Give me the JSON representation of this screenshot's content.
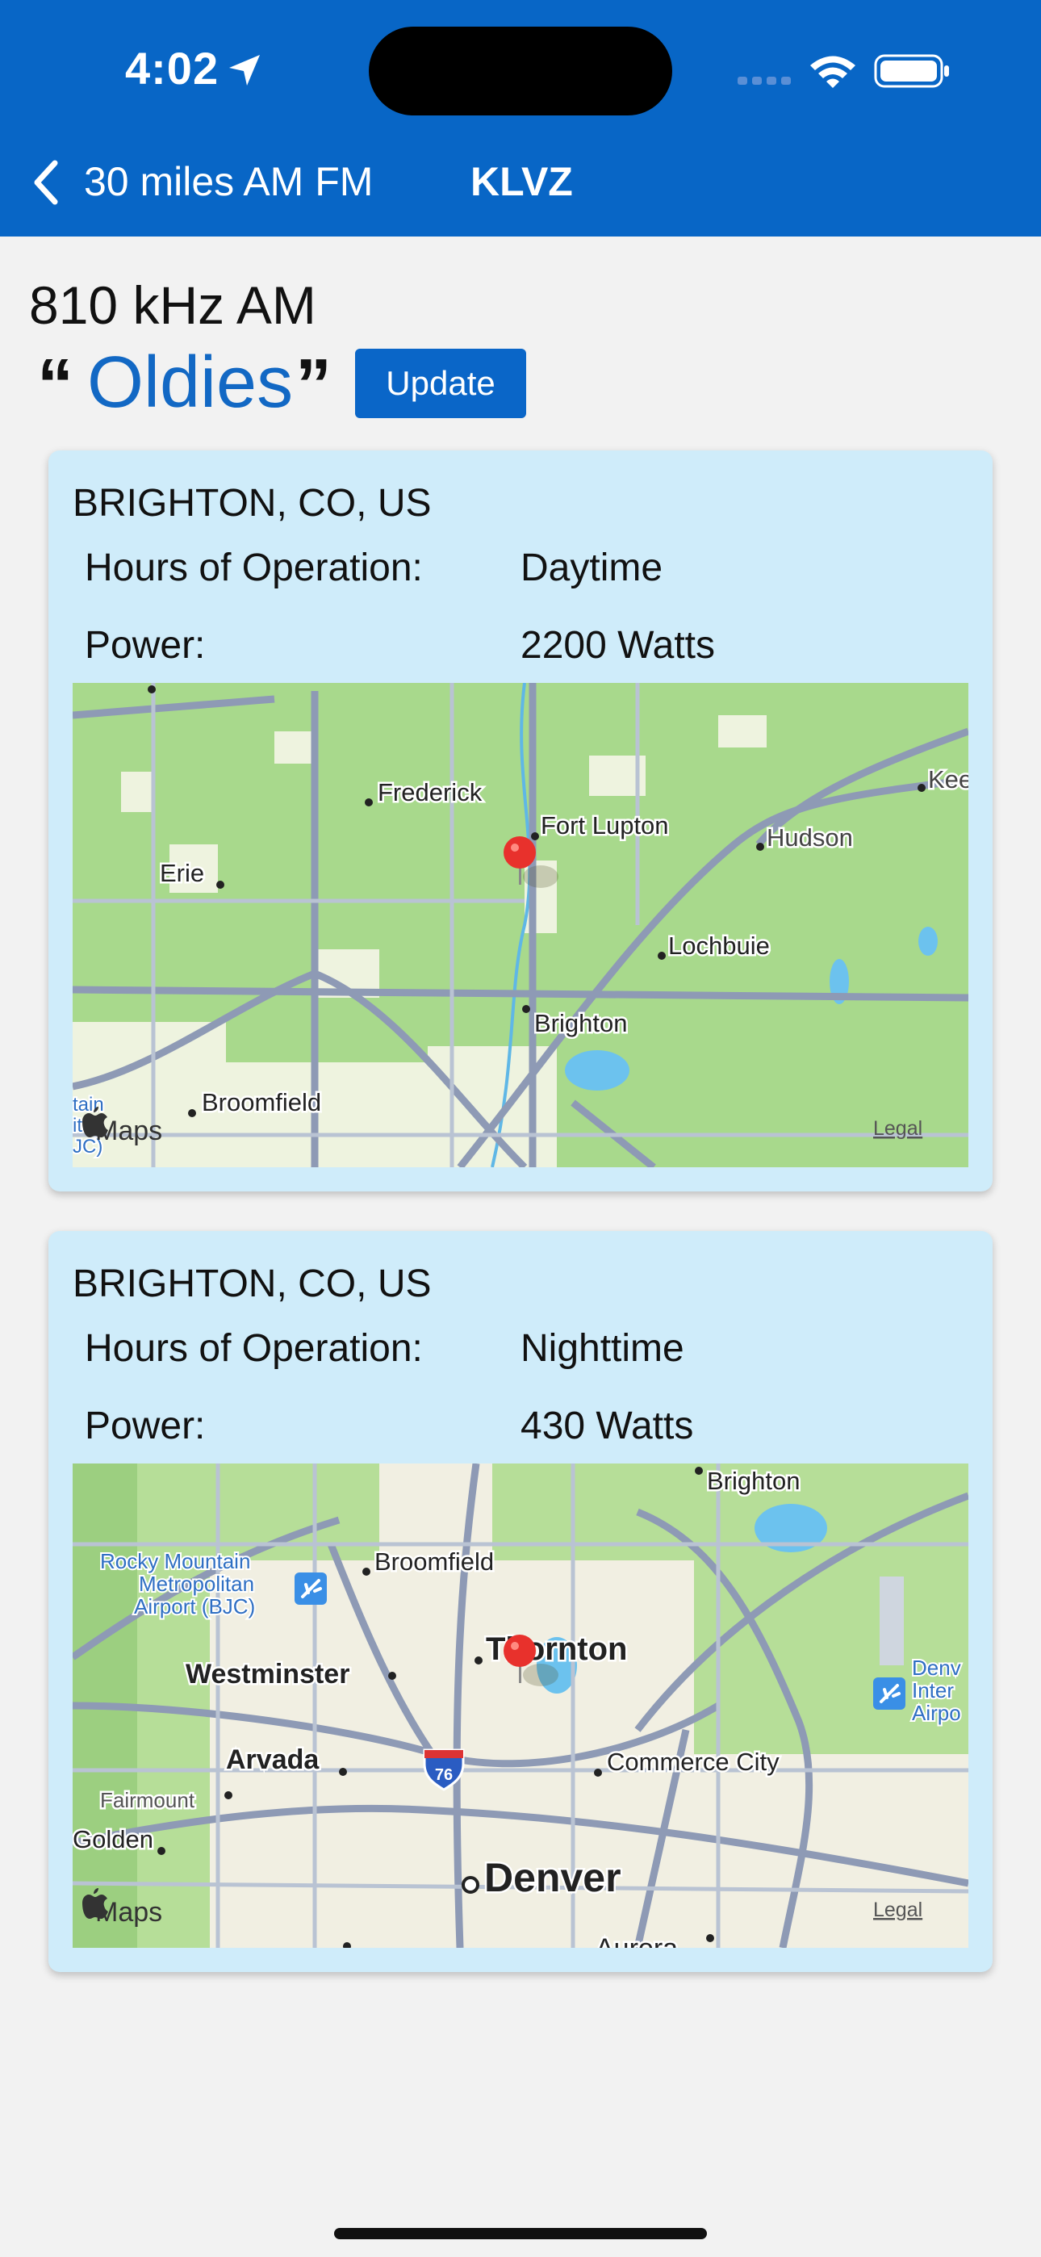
{
  "status_bar": {
    "time": "4:02"
  },
  "nav": {
    "back_label": "30 miles AM FM",
    "title": "KLVZ"
  },
  "station": {
    "frequency": "810 kHz AM",
    "quote_open": "“",
    "genre": "Oldies",
    "quote_close": "”",
    "update_label": "Update"
  },
  "cards": [
    {
      "location": "BRIGHTON, CO, US",
      "hours_label": "Hours of Operation:",
      "hours_value": "Daytime",
      "power_label": "Power:",
      "power_value": "2200 Watts",
      "map": {
        "places": [
          "Frederick",
          "Fort Lupton",
          "Hudson",
          "Kee",
          "Erie",
          "Lochbuie",
          "Brighton",
          "Broomfield",
          "tain",
          "itan",
          "JC)"
        ],
        "maps_logo": "Maps",
        "legal": "Legal"
      }
    },
    {
      "location": "BRIGHTON, CO, US",
      "hours_label": "Hours of Operation:",
      "hours_value": "Nighttime",
      "power_label": "Power:",
      "power_value": "430 Watts",
      "map": {
        "places": [
          "Brighton",
          "Broomfield",
          "Rocky Mountain",
          "Metropolitan",
          "Airport (BJC)",
          "Thornton",
          "Westminster",
          "Denv",
          "Inter",
          "Airpo",
          "Arvada",
          "76",
          "Commerce City",
          "Fairmount",
          "Golden",
          "Denver",
          "Aurora"
        ],
        "maps_logo": "Maps",
        "legal": "Legal"
      }
    }
  ],
  "colors": {
    "accent": "#0866c6",
    "card_bg": "#cfecfa",
    "map_land": "#a8d98c",
    "pin": "#e8312c"
  }
}
